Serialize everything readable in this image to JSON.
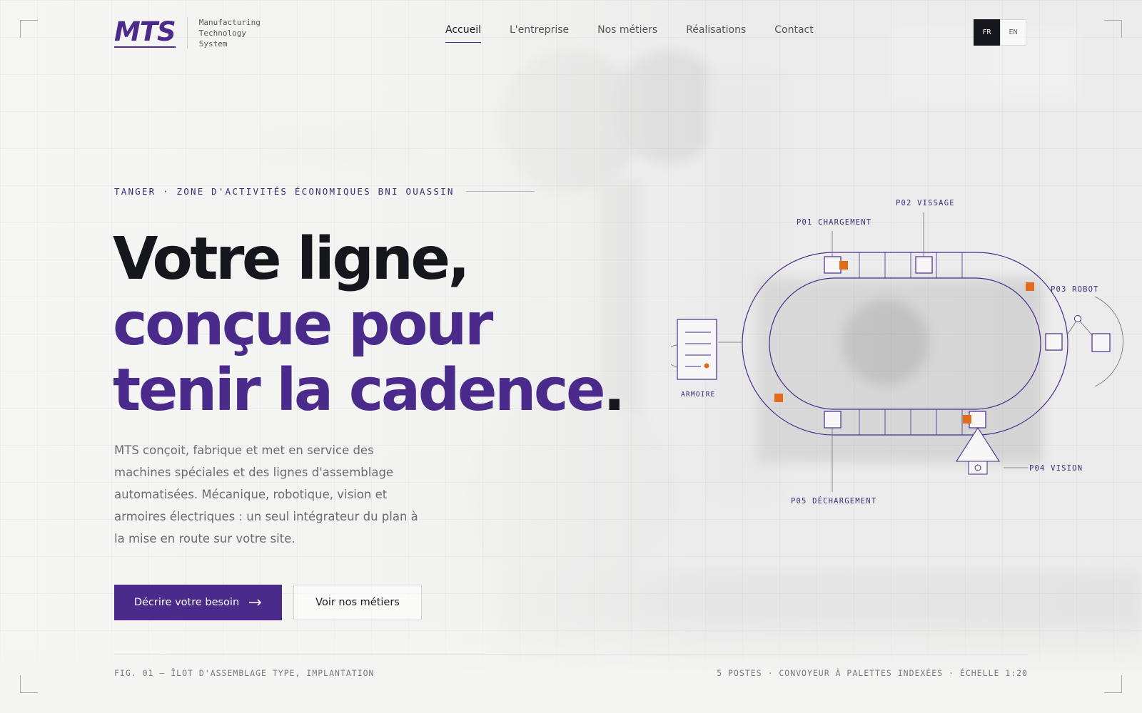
{
  "brand": {
    "logo": "MTS",
    "tagline": [
      "Manufacturing",
      "Technology",
      "System"
    ]
  },
  "nav": {
    "items": [
      {
        "label": "Accueil",
        "active": true
      },
      {
        "label": "L'entreprise",
        "active": false
      },
      {
        "label": "Nos métiers",
        "active": false
      },
      {
        "label": "Réalisations",
        "active": false
      },
      {
        "label": "Contact",
        "active": false
      }
    ]
  },
  "lang": {
    "fr": "FR",
    "en": "EN",
    "selected": "FR"
  },
  "hero": {
    "eyebrow": "TANGER · ZONE D'ACTIVITÉS ÉCONOMIQUES BNI OUASSIN",
    "title_line1": "Votre ligne,",
    "title_line2": "conçue pour",
    "title_line3": "tenir la cadence",
    "title_dot": ".",
    "lead": "MTS conçoit, fabrique et met en service des machines spéciales et des lignes d'assemblage automatisées. Mécanique, robotique, vision et armoires électriques : un seul intégrateur du plan à la mise en route sur votre site.",
    "cta_primary": "Décrire votre besoin",
    "cta_secondary": "Voir nos métiers"
  },
  "diagram": {
    "labels": {
      "p01": "P01 CHARGEMENT",
      "p02": "P02 VISSAGE",
      "p03": "P03 ROBOT",
      "p04": "P04 VISION",
      "p05": "P05 DÉCHARGEMENT",
      "cabinet": "ARMOIRE"
    }
  },
  "footer": {
    "figure_caption": "FIG. 01 — ÎLOT D'ASSEMBLAGE TYPE, IMPLANTATION",
    "specs": "5 POSTES · CONVOYEUR À PALETTES INDEXÉES · ÉCHELLE 1:20"
  },
  "colors": {
    "brand_purple": "#4a2b8c",
    "ink": "#16161d",
    "accent_orange": "#e06a1b"
  }
}
